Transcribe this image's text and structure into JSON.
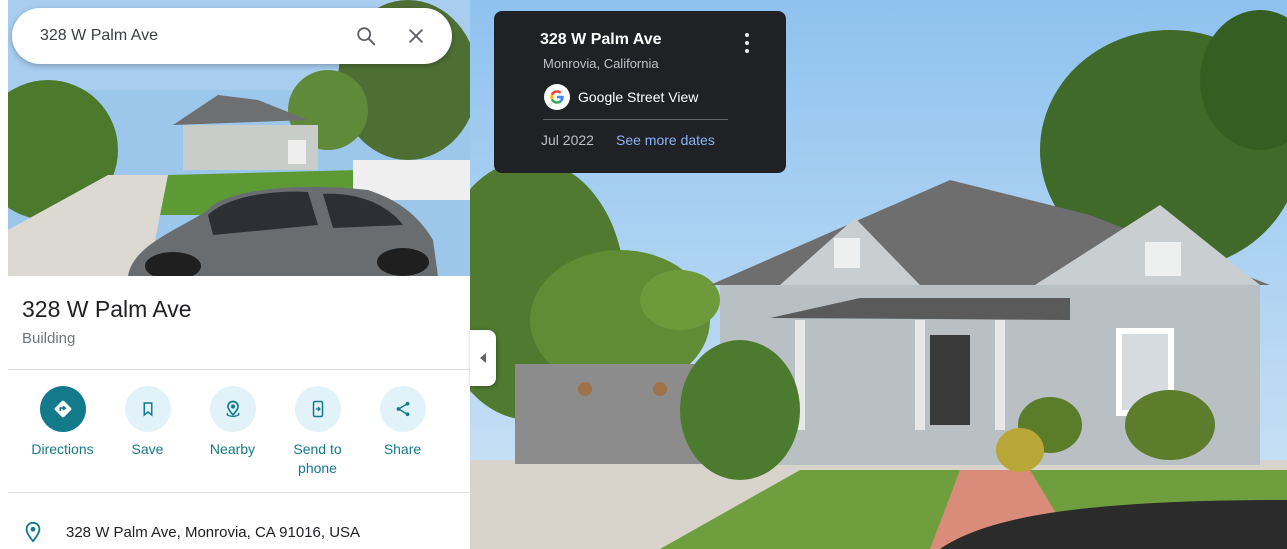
{
  "search": {
    "value": "328 W Palm Ave"
  },
  "place": {
    "title": "328 W Palm Ave",
    "type": "Building"
  },
  "actions": [
    {
      "label": "Directions",
      "icon": "directions-icon"
    },
    {
      "label": "Save",
      "icon": "bookmark-icon"
    },
    {
      "label": "Nearby",
      "icon": "nearby-icon"
    },
    {
      "label": "Send to phone",
      "icon": "send-to-phone-icon"
    },
    {
      "label": "Share",
      "icon": "share-icon"
    }
  ],
  "address": {
    "text": "328 W Palm Ave, Monrovia, CA 91016, USA",
    "icon": "location-pin-icon"
  },
  "card": {
    "title": "328 W Palm Ave",
    "subtitle": "Monrovia, California",
    "brand": "Google Street View",
    "date": "Jul 2022",
    "more_dates": "See more dates"
  },
  "colors": {
    "accent": "#137a8c",
    "accent_light": "#e1f3f8",
    "card_bg": "#202124",
    "link": "#8ab4f8"
  }
}
